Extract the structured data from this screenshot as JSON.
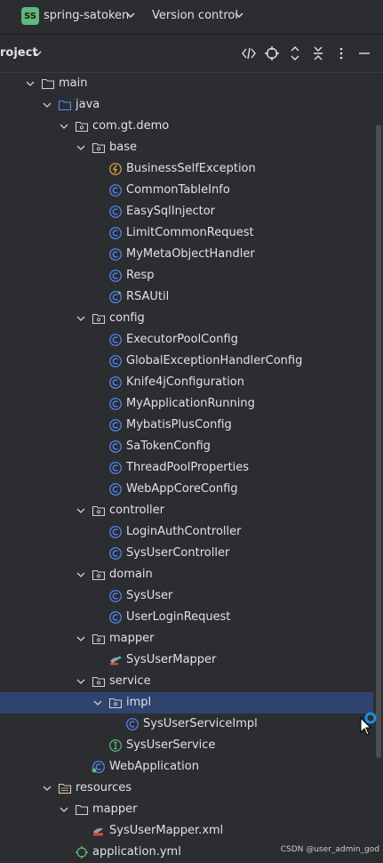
{
  "titlebar": {
    "badge": "SS",
    "project_name": "spring-satoken",
    "vcs_menu": "Version control"
  },
  "panel": {
    "title": "roject"
  },
  "tree": [
    {
      "label": "main",
      "depth": 0,
      "expanded": true,
      "icon": "folder-icon"
    },
    {
      "label": "java",
      "depth": 1,
      "expanded": true,
      "icon": "source-folder-icon"
    },
    {
      "label": "com.gt.demo",
      "depth": 2,
      "expanded": true,
      "icon": "package-icon"
    },
    {
      "label": "base",
      "depth": 3,
      "expanded": true,
      "icon": "package-icon"
    },
    {
      "label": "BusinessSelfException",
      "depth": 4,
      "icon": "exception-class-icon"
    },
    {
      "label": "CommonTableInfo",
      "depth": 4,
      "icon": "class-icon"
    },
    {
      "label": "EasySqlInjector",
      "depth": 4,
      "icon": "class-icon"
    },
    {
      "label": "LimitCommonRequest",
      "depth": 4,
      "icon": "class-icon"
    },
    {
      "label": "MyMetaObjectHandler",
      "depth": 4,
      "icon": "class-icon"
    },
    {
      "label": "Resp",
      "depth": 4,
      "icon": "class-icon"
    },
    {
      "label": "RSAUtil",
      "depth": 4,
      "icon": "class-runnable-icon"
    },
    {
      "label": "config",
      "depth": 3,
      "expanded": true,
      "icon": "package-icon"
    },
    {
      "label": "ExecutorPoolConfig",
      "depth": 4,
      "icon": "class-icon"
    },
    {
      "label": "GlobalExceptionHandlerConfig",
      "depth": 4,
      "icon": "class-icon"
    },
    {
      "label": "Knife4jConfiguration",
      "depth": 4,
      "icon": "class-icon"
    },
    {
      "label": "MyApplicationRunning",
      "depth": 4,
      "icon": "class-icon"
    },
    {
      "label": "MybatisPlusConfig",
      "depth": 4,
      "icon": "class-icon"
    },
    {
      "label": "SaTokenConfig",
      "depth": 4,
      "icon": "class-icon"
    },
    {
      "label": "ThreadPoolProperties",
      "depth": 4,
      "icon": "class-icon"
    },
    {
      "label": "WebAppCoreConfig",
      "depth": 4,
      "icon": "class-icon"
    },
    {
      "label": "controller",
      "depth": 3,
      "expanded": true,
      "icon": "package-icon"
    },
    {
      "label": "LoginAuthController",
      "depth": 4,
      "icon": "class-icon"
    },
    {
      "label": "SysUserController",
      "depth": 4,
      "icon": "class-icon"
    },
    {
      "label": "domain",
      "depth": 3,
      "expanded": true,
      "icon": "package-icon"
    },
    {
      "label": "SysUser",
      "depth": 4,
      "icon": "class-icon"
    },
    {
      "label": "UserLoginRequest",
      "depth": 4,
      "icon": "class-icon"
    },
    {
      "label": "mapper",
      "depth": 3,
      "expanded": true,
      "icon": "package-icon"
    },
    {
      "label": "SysUserMapper",
      "depth": 4,
      "icon": "mybatis-mapper-icon"
    },
    {
      "label": "service",
      "depth": 3,
      "expanded": true,
      "icon": "package-icon"
    },
    {
      "label": "impl",
      "depth": 4,
      "expanded": true,
      "icon": "package-icon",
      "selected": true
    },
    {
      "label": "SysUserServiceImpl",
      "depth": 5,
      "icon": "class-icon"
    },
    {
      "label": "SysUserService",
      "depth": 4,
      "icon": "interface-icon"
    },
    {
      "label": "WebApplication",
      "depth": 3,
      "icon": "spring-boot-app-icon"
    },
    {
      "label": "resources",
      "depth": 1,
      "expanded": true,
      "icon": "resources-folder-icon"
    },
    {
      "label": "mapper",
      "depth": 2,
      "expanded": true,
      "icon": "folder-icon"
    },
    {
      "label": "SysUserMapper.xml",
      "depth": 3,
      "icon": "mybatis-xml-icon"
    },
    {
      "label": "application.yml",
      "depth": 2,
      "icon": "yaml-config-icon"
    }
  ],
  "watermark": "CSDN @user_admin_god",
  "colors": {
    "background": "#2b2d30",
    "selection": "#2e436e",
    "class_icon": "#548af7",
    "badge": "#5fb87a",
    "interface_icon": "#5fb87a"
  }
}
